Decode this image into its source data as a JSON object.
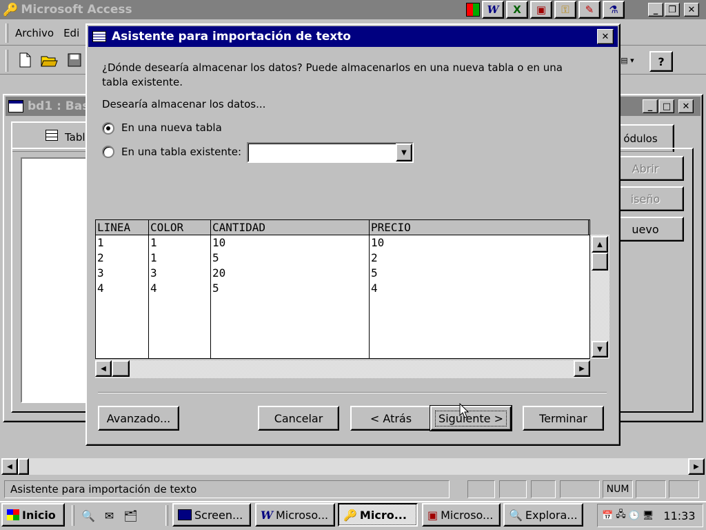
{
  "app": {
    "title": "Microsoft Access",
    "menu": [
      "Archivo",
      "Edi"
    ]
  },
  "db_window": {
    "title": "bd1 : Bas",
    "tab_label": "Tabl",
    "modules_tab": "ódulos",
    "buttons": [
      "Abrir",
      "iseño",
      "uevo"
    ]
  },
  "dialog": {
    "title": "Asistente para importación de texto",
    "question": "¿Dónde desearía almacenar los datos? Puede almacenarlos en una nueva tabla o en una tabla existente.",
    "store_label": "Desearía almacenar los datos...",
    "option_new": "En una nueva tabla",
    "option_existing": "En una tabla existente:",
    "selected_option": "new",
    "existing_table_value": "",
    "grid": {
      "headers": [
        "LINEA",
        "COLOR",
        "CANTIDAD",
        "PRECIO"
      ],
      "rows": [
        [
          "1",
          "1",
          "10",
          "10"
        ],
        [
          "2",
          "1",
          "5",
          "2"
        ],
        [
          "3",
          "3",
          "20",
          "5"
        ],
        [
          "4",
          "4",
          "5",
          "4"
        ]
      ]
    },
    "buttons": {
      "advanced": "Avanzado...",
      "cancel": "Cancelar",
      "back": "< Atrás",
      "next": "Siguiente >",
      "finish": "Terminar"
    }
  },
  "status_bar": {
    "text": "Asistente para importación de texto",
    "num": "NUM"
  },
  "taskbar": {
    "start": "Inicio",
    "tasks": [
      "Screen...",
      "Microso...",
      "Micro...",
      "Microso...",
      "Explora..."
    ],
    "active_task_index": 2,
    "clock": "11:33"
  },
  "colors": {
    "active_title": "#000080",
    "inactive_title": "#808080",
    "face": "#c0c0c0"
  }
}
